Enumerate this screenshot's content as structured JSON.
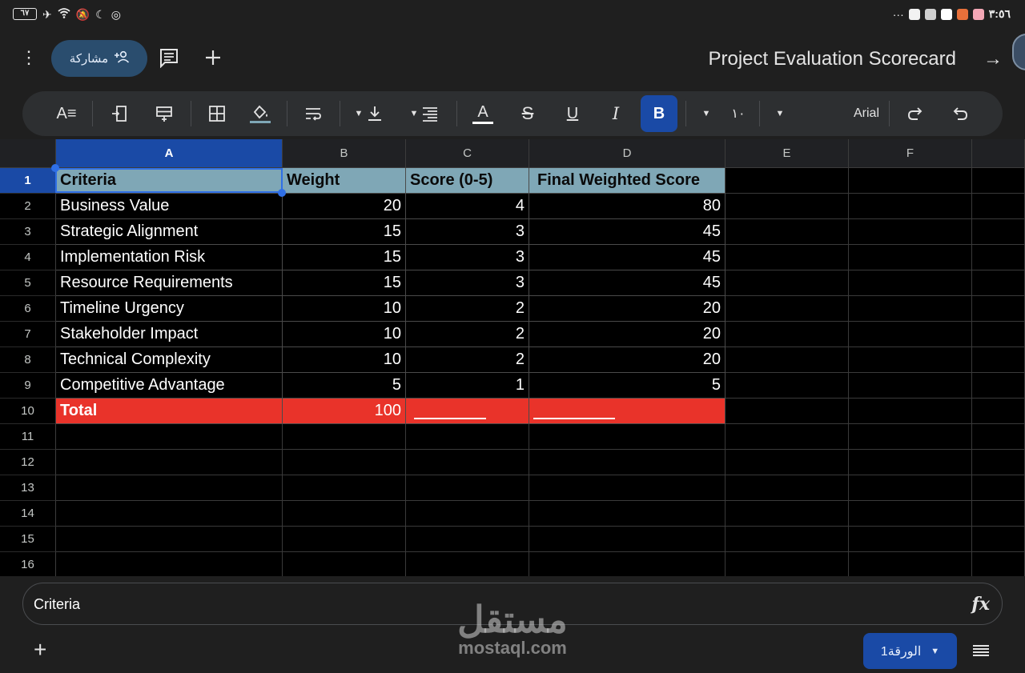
{
  "status": {
    "battery": "٦٧",
    "time": "٣:٥٦",
    "more": "···"
  },
  "appbar": {
    "share_label": "مشاركة",
    "title": "Project Evaluation Scorecard"
  },
  "toolbar": {
    "font_name": "Arial",
    "font_size": "١٠",
    "bold_label": "B",
    "italic_label": "I",
    "underline_label": "U",
    "strike_label": "S",
    "text_color_label": "A"
  },
  "grid": {
    "columns": [
      "A",
      "B",
      "C",
      "D",
      "E",
      "F"
    ],
    "rows": [
      "1",
      "2",
      "3",
      "4",
      "5",
      "6",
      "7",
      "8",
      "9",
      "10",
      "11",
      "12",
      "13",
      "14",
      "15",
      "16"
    ],
    "header": {
      "a": "Criteria",
      "b": "Weight",
      "c": "Score (0-5)",
      "d": "Final Weighted Score"
    },
    "data": [
      {
        "criteria": "Business Value",
        "weight": "20",
        "score": "4",
        "final": "80"
      },
      {
        "criteria": "Strategic Alignment",
        "weight": "15",
        "score": "3",
        "final": "45"
      },
      {
        "criteria": "Implementation Risk",
        "weight": "15",
        "score": "3",
        "final": "45"
      },
      {
        "criteria": "Resource Requirements",
        "weight": "15",
        "score": "3",
        "final": "45"
      },
      {
        "criteria": "Timeline Urgency",
        "weight": "10",
        "score": "2",
        "final": "20"
      },
      {
        "criteria": "Stakeholder Impact",
        "weight": "10",
        "score": "2",
        "final": "20"
      },
      {
        "criteria": "Technical Complexity",
        "weight": "10",
        "score": "2",
        "final": "20"
      },
      {
        "criteria": "Competitive Advantage",
        "weight": "5",
        "score": "1",
        "final": "5"
      }
    ],
    "total": {
      "label": "Total",
      "weight": "100"
    },
    "colors": {
      "header_bg": "#7fa7b6",
      "total_bg": "#e9332a",
      "selection": "#1a4aa6"
    }
  },
  "formula_bar": {
    "value": "Criteria",
    "fx_label": "fx"
  },
  "bottom": {
    "add_label": "+",
    "sheet_tab": "الورقة1"
  },
  "watermark": {
    "arabic": "مستقل",
    "latin": "mostaql.com"
  }
}
